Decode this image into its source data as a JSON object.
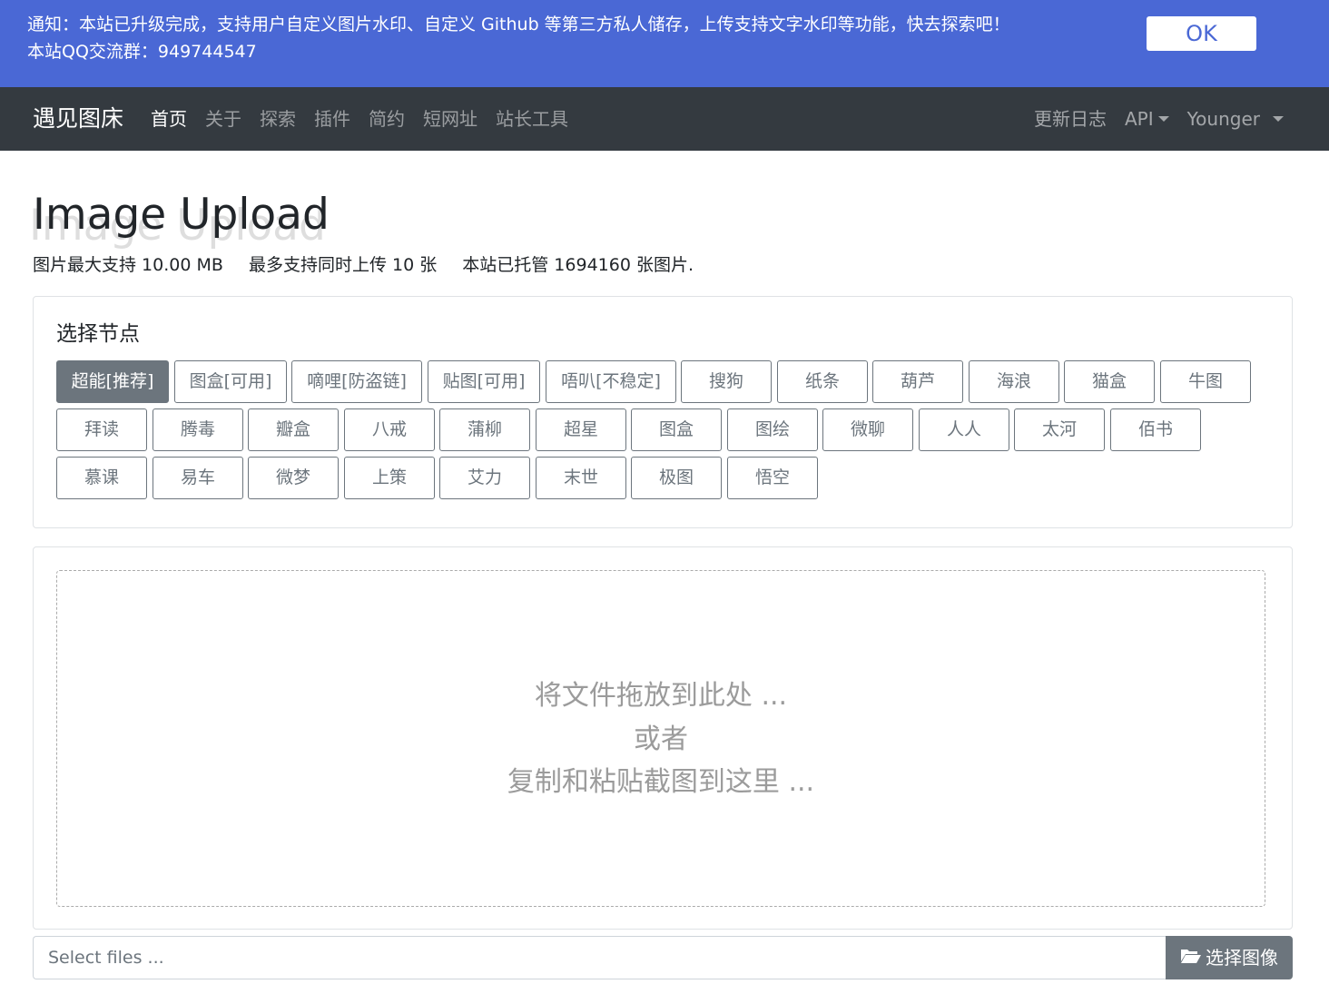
{
  "notice": {
    "line1": "通知：本站已升级完成，支持用户自定义图片水印、自定义 Github 等第三方私人储存，上传支持文字水印等功能，快去探索吧！",
    "line2": "本站QQ交流群：949744547",
    "ok_label": "OK",
    "color": "#4a68d5"
  },
  "navbar": {
    "brand": "遇见图床",
    "left_links": [
      "首页",
      "关于",
      "探索",
      "插件",
      "简约",
      "短网址",
      "站长工具"
    ],
    "changelog": "更新日志",
    "api": "API",
    "user": "Younger",
    "color": "#343a40"
  },
  "header": {
    "title": "Image Upload",
    "max_size": "图片最大支持 10.00 MB",
    "max_count": "最多支持同时上传 10 张",
    "hosted": "本站已托管 1694160 张图片."
  },
  "node_selector": {
    "title": "选择节点",
    "selected": "超能[推荐]",
    "rows": [
      [
        "超能[推荐]",
        "图盒[可用]",
        "嘀哩[防盗链]",
        "贴图[可用]",
        "唔叭[不稳定]",
        "搜狗",
        "纸条",
        "葫芦",
        "海浪",
        "猫盒",
        "牛图"
      ],
      [
        "拜读",
        "腾毒",
        "瓣盒",
        "八戒",
        "蒲柳",
        "超星",
        "图盒",
        "图绘",
        "微聊",
        "人人",
        "太河",
        "佰书"
      ],
      [
        "慕课",
        "易车",
        "微梦",
        "上策",
        "艾力",
        "末世",
        "极图",
        "悟空"
      ]
    ]
  },
  "dropzone": {
    "line1": "将文件拖放到此处 ...",
    "line2": "或者",
    "line3": "复制和粘贴截图到这里 ..."
  },
  "file_select": {
    "placeholder": "Select files ...",
    "button_label": "选择图像",
    "button_icon": "folder-open-icon"
  }
}
